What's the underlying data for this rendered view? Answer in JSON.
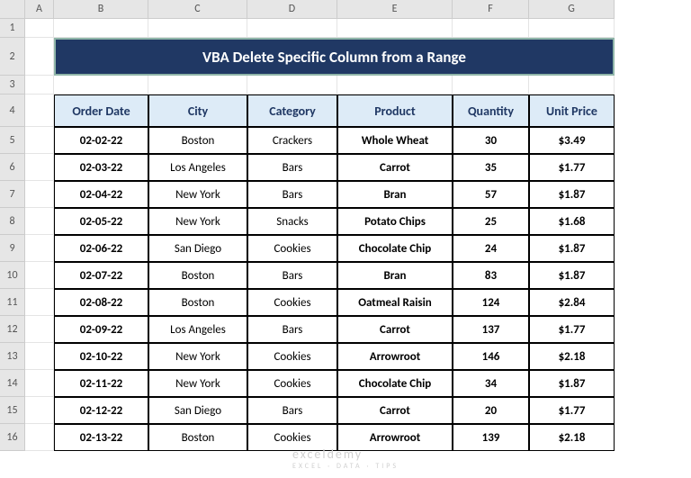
{
  "columns": [
    "A",
    "B",
    "C",
    "D",
    "E",
    "F",
    "G"
  ],
  "row_numbers": [
    1,
    2,
    3,
    4,
    5,
    6,
    7,
    8,
    9,
    10,
    11,
    12,
    13,
    14,
    15,
    16
  ],
  "title": "VBA Delete Specific Column from a Range",
  "headers": [
    "Order Date",
    "City",
    "Category",
    "Product",
    "Quantity",
    "Unit Price"
  ],
  "rows": [
    {
      "date": "02-02-22",
      "city": "Boston",
      "cat": "Crackers",
      "prod": "Whole Wheat",
      "qty": "30",
      "price": "$3.49"
    },
    {
      "date": "02-03-22",
      "city": "Los Angeles",
      "cat": "Bars",
      "prod": "Carrot",
      "qty": "35",
      "price": "$1.77"
    },
    {
      "date": "02-04-22",
      "city": "New York",
      "cat": "Bars",
      "prod": "Bran",
      "qty": "57",
      "price": "$1.87"
    },
    {
      "date": "02-05-22",
      "city": "New York",
      "cat": "Snacks",
      "prod": "Potato Chips",
      "qty": "25",
      "price": "$1.68"
    },
    {
      "date": "02-06-22",
      "city": "San Diego",
      "cat": "Cookies",
      "prod": "Chocolate Chip",
      "qty": "24",
      "price": "$1.87"
    },
    {
      "date": "02-07-22",
      "city": "Boston",
      "cat": "Bars",
      "prod": "Bran",
      "qty": "83",
      "price": "$1.87"
    },
    {
      "date": "02-08-22",
      "city": "Boston",
      "cat": "Cookies",
      "prod": "Oatmeal Raisin",
      "qty": "124",
      "price": "$2.84"
    },
    {
      "date": "02-09-22",
      "city": "Los Angeles",
      "cat": "Bars",
      "prod": "Carrot",
      "qty": "137",
      "price": "$1.77"
    },
    {
      "date": "02-10-22",
      "city": "New York",
      "cat": "Cookies",
      "prod": "Arrowroot",
      "qty": "146",
      "price": "$2.18"
    },
    {
      "date": "02-11-22",
      "city": "New York",
      "cat": "Cookies",
      "prod": "Chocolate Chip",
      "qty": "34",
      "price": "$1.87"
    },
    {
      "date": "02-12-22",
      "city": "San Diego",
      "cat": "Bars",
      "prod": "Carrot",
      "qty": "20",
      "price": "$1.77"
    },
    {
      "date": "02-13-22",
      "city": "Boston",
      "cat": "Cookies",
      "prod": "Arrowroot",
      "qty": "139",
      "price": "$2.18"
    }
  ],
  "watermark": {
    "main": "exceldemy",
    "sub": "EXCEL · DATA · TIPS"
  }
}
